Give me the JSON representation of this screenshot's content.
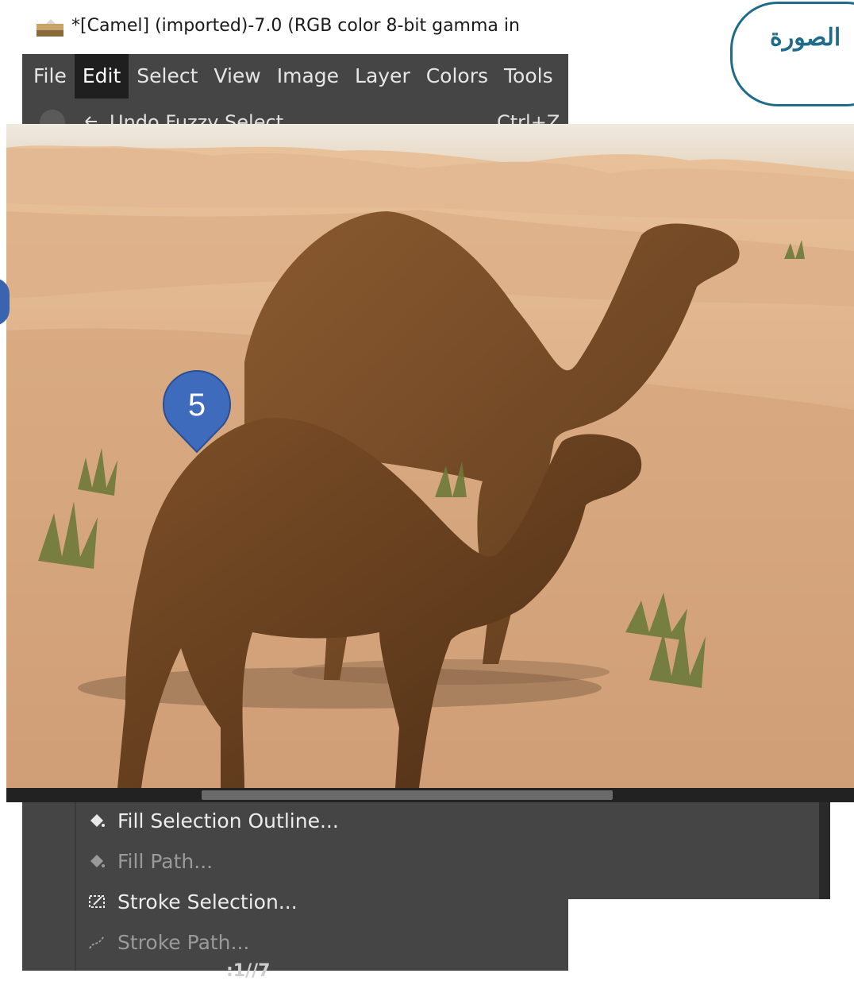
{
  "window": {
    "title": "*[Camel] (imported)-7.0 (RGB color 8-bit gamma in"
  },
  "menubar": {
    "items": [
      {
        "label": "File"
      },
      {
        "label": "Edit",
        "active": true
      },
      {
        "label": "Select"
      },
      {
        "label": "View"
      },
      {
        "label": "Image"
      },
      {
        "label": "Layer"
      },
      {
        "label": "Colors"
      },
      {
        "label": "Tools"
      }
    ]
  },
  "edit_menu": {
    "undo": {
      "label": "Undo Fuzzy Select",
      "shortcut": "Ctrl+Z"
    },
    "fill_selection_outline": {
      "label": "Fill Selection Outline...",
      "enabled": true
    },
    "fill_path": {
      "label": "Fill Path...",
      "enabled": false
    },
    "stroke_selection": {
      "label": "Stroke Selection...",
      "enabled": true
    },
    "stroke_path": {
      "label": "Stroke Path...",
      "enabled": false
    },
    "next_partial": ":1//7"
  },
  "annotation": {
    "arabic_label": "الصورة",
    "step_number": "5",
    "bubble_color": "#1f6b8a",
    "marker_color": "#3a64b0"
  },
  "image_canvas": {
    "content": "desert-camels-photo"
  }
}
